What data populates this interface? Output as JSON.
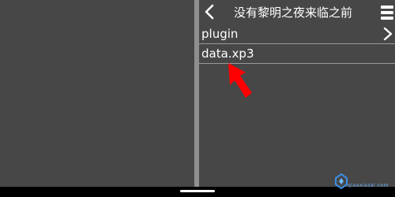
{
  "header": {
    "back_icon": "chevron-left-icon",
    "title": "没有黎明之夜来临之前",
    "menu_icon": "hamburger-menu-icon"
  },
  "files": [
    {
      "label": "plugin",
      "type": "folder",
      "icon": "chevron-right-icon"
    },
    {
      "label": "data.xp3",
      "type": "file"
    }
  ],
  "annotation": {
    "icon": "red-arrow-icon",
    "color": "#ff0000"
  },
  "watermark": {
    "text": "qiaaxiazai.com",
    "icon": "logo-icon"
  },
  "colors": {
    "background": "#474747",
    "divider": "#8f8f8f",
    "text": "#ffffff",
    "row_separator": "#9a9a9a"
  }
}
